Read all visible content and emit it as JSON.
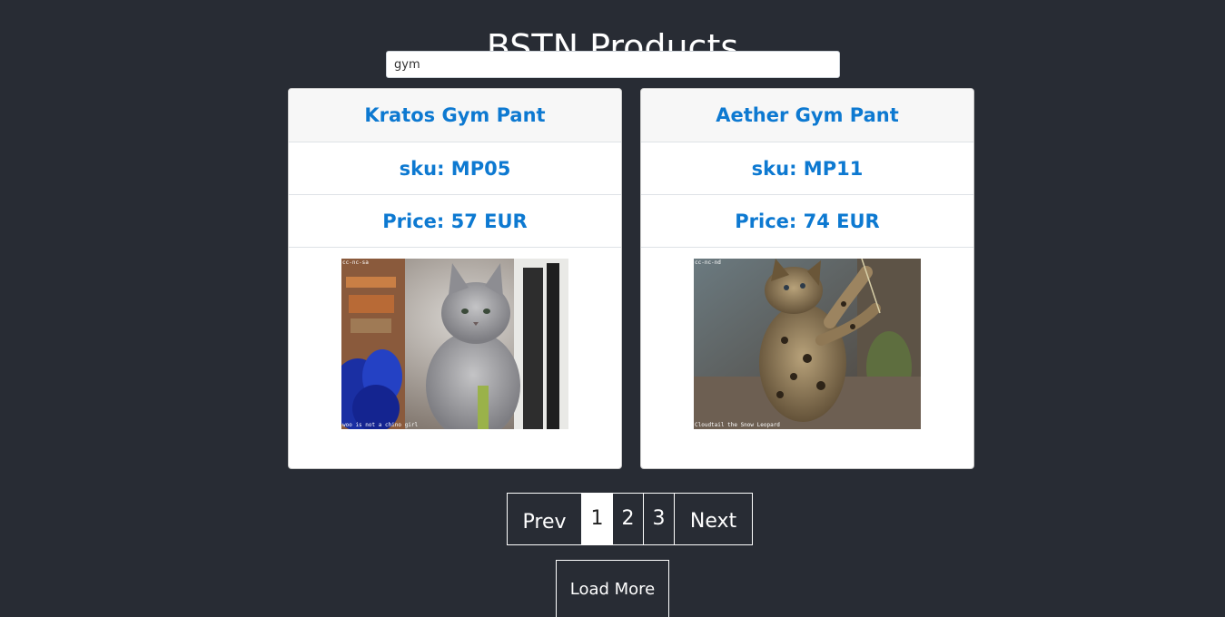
{
  "header": {
    "title": "BSTN Products"
  },
  "search": {
    "value": "gym"
  },
  "products": [
    {
      "name": "Kratos Gym Pant",
      "sku_label": "sku: MP05",
      "price_label": "Price: 57 EUR",
      "image": {
        "badge": "cc-nc-sa",
        "caption": "woo is not a chino girl"
      }
    },
    {
      "name": "Aether Gym Pant",
      "sku_label": "sku: MP11",
      "price_label": "Price: 74 EUR",
      "image": {
        "badge": "cc-nc-nd",
        "caption": "Cloudtail the Snow Leopard"
      }
    }
  ],
  "pagination": {
    "prev_label": "Prev",
    "pages": [
      "1",
      "2",
      "3"
    ],
    "current_page": "1",
    "next_label": "Next"
  },
  "load_more_label": "Load More",
  "colors": {
    "background": "#282c34",
    "accent": "#0d79d1",
    "card_header": "#f7f7f7"
  }
}
